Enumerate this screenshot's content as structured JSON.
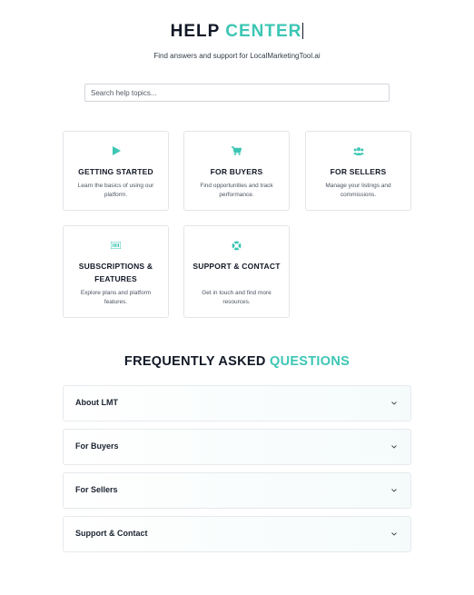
{
  "hero": {
    "title_main": "HELP",
    "title_accent": "CENTER",
    "subtitle": "Find answers and support for LocalMarketingTool.ai"
  },
  "search": {
    "placeholder": "Search help topics..."
  },
  "categories": [
    {
      "icon": "play-icon",
      "title": "GETTING STARTED",
      "description": "Learn the basics of using our platform."
    },
    {
      "icon": "cart-icon",
      "title": "FOR BUYERS",
      "description": "Find opportunities and track performance."
    },
    {
      "icon": "users-icon",
      "title": "FOR SELLERS",
      "description": "Manage your listings and commissions."
    },
    {
      "icon": "barcode-icon",
      "title": "SUBSCRIPTIONS & FEATURES",
      "description": "Explore plans and platform features."
    },
    {
      "icon": "lifebuoy-icon",
      "title": "SUPPORT & CONTACT",
      "description": "Get in touch and find more resources."
    }
  ],
  "faq": {
    "title_main": "FREQUENTLY ASKED",
    "title_accent": "QUESTIONS",
    "items": [
      {
        "label": "About LMT"
      },
      {
        "label": "For Buyers"
      },
      {
        "label": "For Sellers"
      },
      {
        "label": "Support & Contact"
      }
    ]
  },
  "colors": {
    "accent": "#3cc6b4",
    "heading": "#121826",
    "border": "#e2e5e9"
  }
}
